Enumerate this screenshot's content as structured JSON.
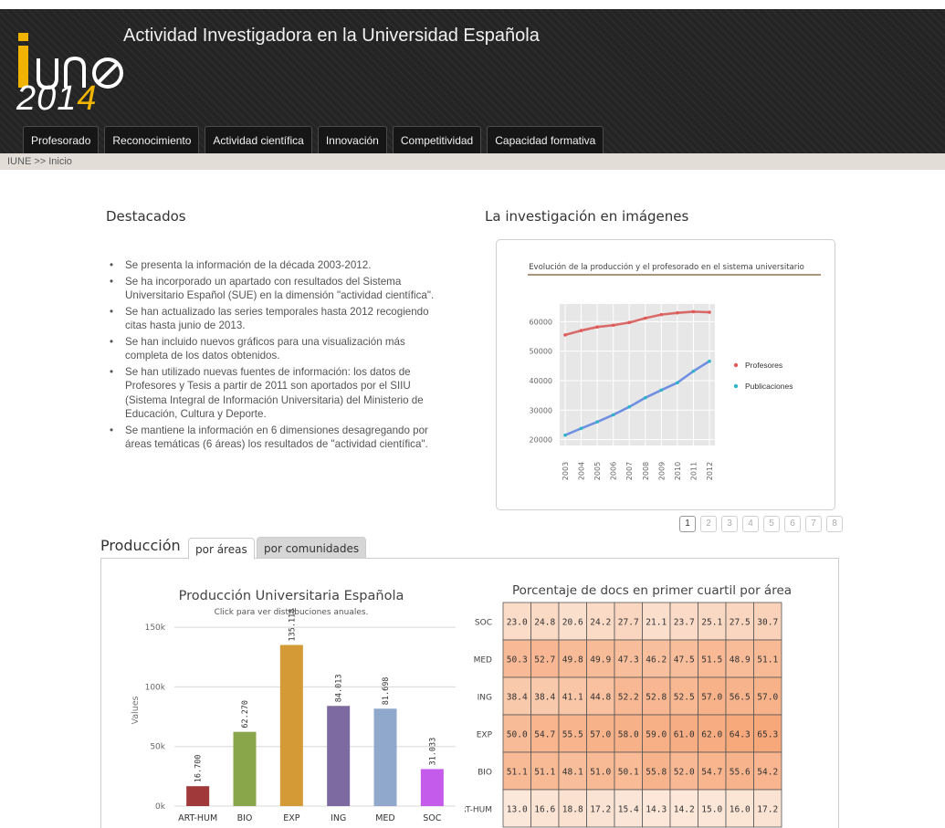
{
  "header": {
    "logo_text": "iun",
    "year_prefix": "201",
    "year_suffix": "4",
    "title": "Actividad Investigadora en la Universidad Española"
  },
  "nav": {
    "tabs": [
      "Profesorado",
      "Reconocimiento",
      "Actividad científica",
      "Innovación",
      "Competitividad",
      "Capacidad formativa"
    ]
  },
  "breadcrumb": "IUNE >> Inicio",
  "highlights": {
    "title": "Destacados",
    "items": [
      "Se presenta la información de la década 2003-2012.",
      "Se ha incorporado un apartado con resultados del Sistema Universitario Español (SUE) en la dimensión \"actividad científica\".",
      "Se han actualizado las series temporales hasta 2012 recogiendo citas hasta junio de 2013.",
      "Se han incluido nuevos gráficos para una visualización más completa de los datos obtenidos.",
      "Se han utilizado nuevas fuentes de información: los datos de Profesores y Tesis a partir de 2011 son aportados por el SIIU (Sistema Integral de Información Universitaria) del Ministerio de Educación, Cultura y Deporte.",
      "Se mantiene la información en 6 dimensiones desagregando por áreas temáticas (6 áreas) los resultados de \"actividad científica\"."
    ]
  },
  "images": {
    "title": "La investigación en imágenes",
    "pager": [
      "1",
      "2",
      "3",
      "4",
      "5",
      "6",
      "7",
      "8"
    ],
    "active_page": "1"
  },
  "production": {
    "title": "Producción",
    "tab_areas": "por áreas",
    "tab_communities": "por comunidades"
  },
  "chart_data": [
    {
      "type": "line",
      "title": "Evolución de la producción y el profesorado en el sistema universitario",
      "x": [
        "2003",
        "2004",
        "2005",
        "2006",
        "2007",
        "2008",
        "2009",
        "2010",
        "2011",
        "2012"
      ],
      "ylim": [
        18000,
        66000
      ],
      "yticks": [
        20000,
        30000,
        40000,
        50000,
        60000
      ],
      "legend": "right",
      "series": [
        {
          "name": "Profesores",
          "color": "#e05a5a",
          "values": [
            55500,
            57000,
            58200,
            58800,
            59700,
            61200,
            62400,
            63000,
            63400,
            63200
          ]
        },
        {
          "name": "Publicaciones",
          "color": "#2bb6c7",
          "values": [
            21500,
            23800,
            26000,
            28400,
            31100,
            34200,
            36800,
            39300,
            43200,
            46600
          ]
        }
      ]
    },
    {
      "type": "bar",
      "title": "Producción Universitaria Española",
      "subtitle": "Click para ver distribuciones anuales.",
      "ylabel": "Values",
      "ylim": [
        0,
        160000
      ],
      "yticks": [
        0,
        50000,
        100000,
        150000
      ],
      "ytick_labels": [
        "0k",
        "50k",
        "100k",
        "150k"
      ],
      "categories": [
        "ART-HUM",
        "BIO",
        "EXP",
        "ING",
        "MED",
        "SOC"
      ],
      "values": [
        16700,
        62270,
        135118,
        84013,
        81698,
        31033
      ],
      "value_labels": [
        "16.700",
        "62.270",
        "135.118",
        "84.013",
        "81.698",
        "31.033"
      ],
      "colors": [
        "#a03a3a",
        "#8aa64a",
        "#d39a35",
        "#7c6aa0",
        "#8fa8cc",
        "#c55bea"
      ]
    },
    {
      "type": "heatmap",
      "title": "Porcentaje de docs en primer cuartil por área",
      "rows": [
        "SOC",
        "MED",
        "ING",
        "EXP",
        "BIO",
        "ART-HUM"
      ],
      "values": [
        [
          23.0,
          24.8,
          20.6,
          24.2,
          27.7,
          21.1,
          23.7,
          25.1,
          27.5,
          30.7
        ],
        [
          50.3,
          52.7,
          49.8,
          49.9,
          47.3,
          46.2,
          47.5,
          51.5,
          48.9,
          51.1
        ],
        [
          38.4,
          38.4,
          41.1,
          44.8,
          52.2,
          52.8,
          52.5,
          57.0,
          56.5,
          57.0
        ],
        [
          50.0,
          54.7,
          55.5,
          57.0,
          58.0,
          59.0,
          61.0,
          62.0,
          64.3,
          65.3
        ],
        [
          51.1,
          51.1,
          48.1,
          51.0,
          50.1,
          55.8,
          52.0,
          54.7,
          55.6,
          54.2
        ],
        [
          13.0,
          16.6,
          18.8,
          17.2,
          15.4,
          14.3,
          14.2,
          15.0,
          16.0,
          17.2
        ]
      ]
    }
  ]
}
